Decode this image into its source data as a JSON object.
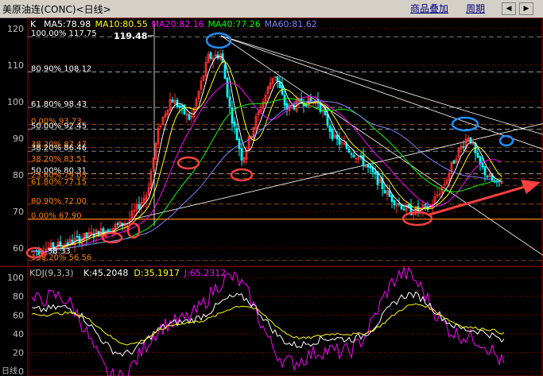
{
  "titlebar": {
    "title": "美原油连(CONC)<日线>",
    "overlay_button": "商品叠加",
    "period_button": "周期",
    "nav_left_glyph": "◀",
    "nav_right_glyph": "▶"
  },
  "main_panel": {
    "indicator_label": "K",
    "ma": [
      {
        "label": "MA5:78.98",
        "color": "#ffffff"
      },
      {
        "label": "MA10:80.55",
        "color": "#ffff00"
      },
      {
        "label": "MA20:82.16",
        "color": "#ff00ff"
      },
      {
        "label": "MA40:77.26",
        "color": "#00ff00"
      },
      {
        "label": "MA60:81.62",
        "color": "#8080ff"
      }
    ],
    "y_ticks": [
      "120",
      "110",
      "100",
      "90",
      "80",
      "70",
      "60"
    ],
    "y_tick_values": [
      120,
      110,
      100,
      90,
      80,
      70,
      60
    ],
    "y_range": [
      55,
      123
    ],
    "high_marker": "119.48",
    "low_marker": "58.33",
    "fib_levels": [
      {
        "label": "100.00% 117.75",
        "value": 117.75,
        "color": "#ffffff"
      },
      {
        "label": "80.90% 108.12",
        "value": 108.12,
        "color": "#ffffff"
      },
      {
        "label": "61.80% 98.43",
        "value": 98.43,
        "color": "#ffffff"
      },
      {
        "label": "0.00% 93.73",
        "value": 93.73,
        "color": "#ff8000"
      },
      {
        "label": "50.00% 92.45",
        "value": 92.45,
        "color": "#ffffff"
      },
      {
        "label": "38.20% 87.47",
        "value": 87.47,
        "color": "#ff8000"
      },
      {
        "label": "38.20% 86.46",
        "value": 86.46,
        "color": "#ffffff"
      },
      {
        "label": "38.20% 83.51",
        "value": 83.51,
        "color": "#ff8000"
      },
      {
        "label": "50.00% 80.31",
        "value": 80.31,
        "color": "#ffffff"
      },
      {
        "label": "23.60% 79.05",
        "value": 79.05,
        "color": "#ff8000"
      },
      {
        "label": "61.80% 77.15",
        "value": 77.15,
        "color": "#ff8000"
      },
      {
        "label": "80.90% 72.00",
        "value": 72.0,
        "color": "#ff8000"
      },
      {
        "label": "0.00% 67.90",
        "value": 67.9,
        "color": "#ff8000"
      },
      {
        "label": "138.20% 56.56",
        "value": 56.56,
        "color": "#ff8000"
      }
    ]
  },
  "kdj_panel": {
    "label": "KDJ(9,3,3)",
    "values": [
      {
        "label": "K:45.2048",
        "color": "#ffffff"
      },
      {
        "label": "D:35.1917",
        "color": "#ffff00"
      },
      {
        "label": "J:65.2312",
        "color": "#ff00ff"
      }
    ],
    "y_ticks": [
      "100",
      "80",
      "60",
      "40",
      "20",
      "0"
    ],
    "y_tick_values": [
      100,
      80,
      60,
      40,
      20,
      0
    ],
    "y_range": [
      -5,
      112
    ]
  },
  "bottom_label": "日线",
  "colors": {
    "up_candle": "#ff3030",
    "down_candle": "#00ffff",
    "grid": "#b00000",
    "annotation_red": "#ff4040",
    "annotation_blue": "#1e90ff"
  }
}
